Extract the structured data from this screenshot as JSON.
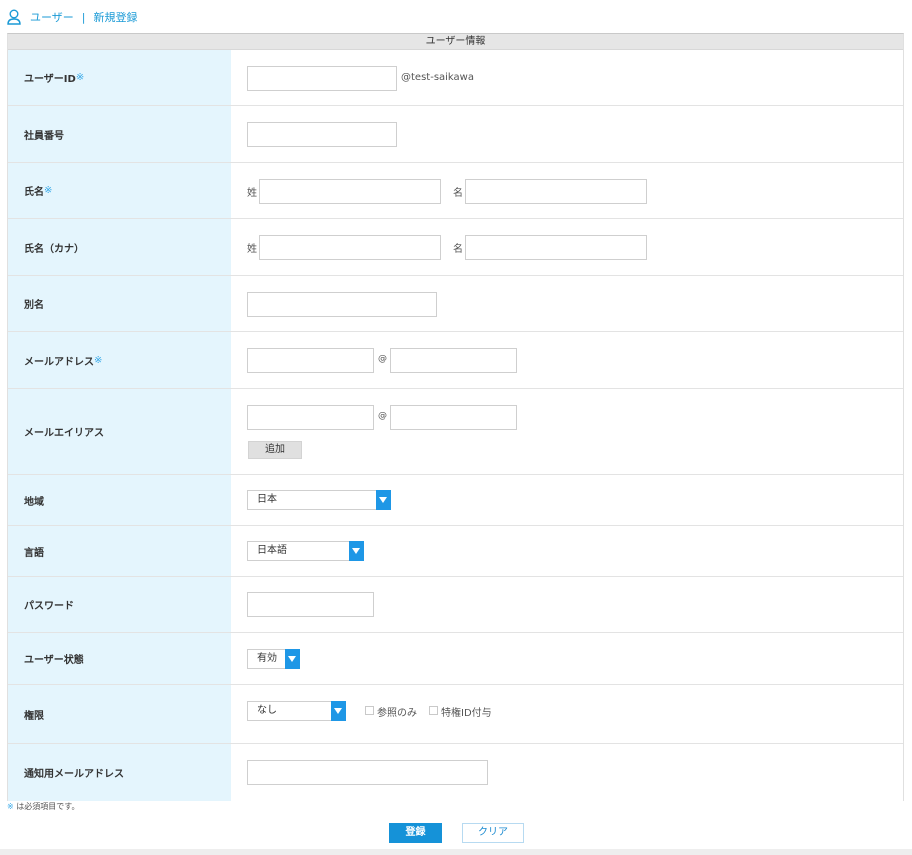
{
  "breadcrumb": {
    "section": "ユーザー",
    "separator": "|",
    "page": "新規登録"
  },
  "section_title": "ユーザー情報",
  "required_mark": "※",
  "fields": {
    "user_id": {
      "label": "ユーザーID",
      "domain_suffix": "@test-saikawa"
    },
    "employee_no": {
      "label": "社員番号"
    },
    "name": {
      "label": "氏名",
      "last": "姓",
      "first": "名"
    },
    "name_kana": {
      "label": "氏名（カナ）",
      "last": "姓",
      "first": "名"
    },
    "alias": {
      "label": "別名"
    },
    "email": {
      "label": "メールアドレス",
      "at": "@"
    },
    "email_alias": {
      "label": "メールエイリアス",
      "at": "@",
      "add_button": "追加"
    },
    "region": {
      "label": "地域",
      "selected": "日本"
    },
    "language": {
      "label": "言語",
      "selected": "日本語"
    },
    "password": {
      "label": "パスワード"
    },
    "status": {
      "label": "ユーザー状態",
      "selected": "有効"
    },
    "permission": {
      "label": "権限",
      "selected": "なし",
      "read_only": "参照のみ",
      "privileged_id": "特権ID付与"
    },
    "notify_email": {
      "label": "通知用メールアドレス"
    }
  },
  "footnote": "は必須項目です。",
  "buttons": {
    "submit": "登録",
    "clear": "クリア"
  },
  "colors": {
    "accent": "#1a9ad6",
    "label_bg": "#e4f5fd",
    "select_arrow": "#1e97e6",
    "submit_bg": "#1592d8"
  }
}
